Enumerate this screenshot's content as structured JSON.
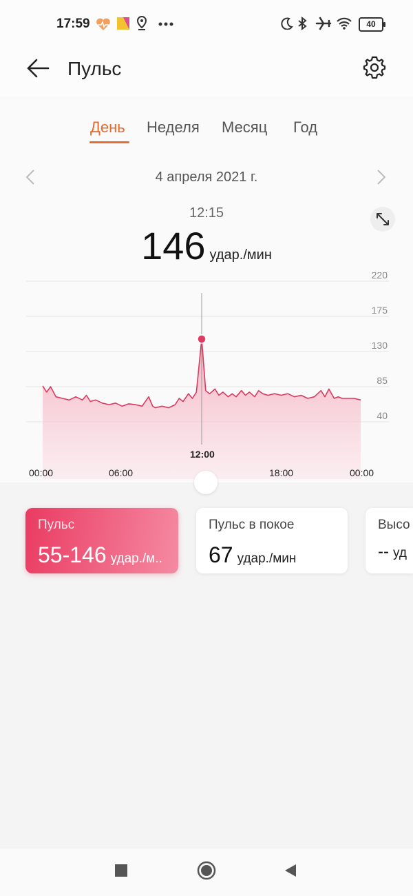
{
  "status_bar": {
    "time": "17:59",
    "left_icons": [
      "heart-rate-icon",
      "app-icon",
      "location-icon",
      "more-dots-icon"
    ],
    "right_icons": [
      "moon-icon",
      "bluetooth-icon",
      "airplane-icon",
      "wifi-icon"
    ],
    "battery": "40"
  },
  "header": {
    "title": "Пульс"
  },
  "tabs": [
    {
      "label": "День",
      "active": true
    },
    {
      "label": "Неделя",
      "active": false
    },
    {
      "label": "Месяц",
      "active": false
    },
    {
      "label": "Год",
      "active": false
    }
  ],
  "date_nav": {
    "date": "4 апреля 2021 г."
  },
  "reading": {
    "time": "12:15",
    "value": "146",
    "unit": "удар./мин"
  },
  "chart_data": {
    "type": "area",
    "x_ticks": [
      "00:00",
      "06:00",
      "12:00",
      "18:00",
      "00:00"
    ],
    "selected_x": "12:00",
    "y_ticks": [
      "220",
      "175",
      "130",
      "85",
      "40"
    ],
    "ylim": [
      40,
      220
    ],
    "x_hours": [
      0,
      0.3,
      0.6,
      1,
      1.5,
      2,
      2.5,
      3,
      3.3,
      3.6,
      4,
      4.5,
      5,
      5.5,
      6,
      6.5,
      7,
      7.5,
      8,
      8.3,
      8.5,
      9,
      9.5,
      10,
      10.3,
      10.6,
      11,
      11.3,
      11.6,
      12,
      12.3,
      12.6,
      13,
      13.3,
      13.6,
      14,
      14.3,
      14.6,
      15,
      15.3,
      15.6,
      16,
      16.3,
      16.6,
      17,
      17.5,
      18,
      18.5,
      19,
      19.5,
      20,
      20.5,
      21,
      21.3,
      21.6,
      22,
      22.3,
      22.6,
      23,
      23.5,
      24
    ],
    "y_values": [
      86,
      78,
      85,
      72,
      70,
      68,
      72,
      68,
      74,
      66,
      68,
      64,
      62,
      64,
      60,
      63,
      62,
      60,
      72,
      60,
      58,
      60,
      58,
      62,
      70,
      66,
      76,
      70,
      78,
      146,
      80,
      76,
      82,
      74,
      78,
      72,
      76,
      72,
      80,
      74,
      78,
      72,
      80,
      76,
      74,
      76,
      74,
      76,
      72,
      74,
      70,
      72,
      80,
      72,
      82,
      70,
      72,
      70,
      70,
      70,
      68
    ],
    "highlight": {
      "x": 12,
      "y": 146
    }
  },
  "cards": [
    {
      "label": "Пульс",
      "value": "55-146",
      "unit": "удар./м..",
      "active": true
    },
    {
      "label": "Пульс в покое",
      "value": "67",
      "unit": "удар./мин",
      "active": false
    },
    {
      "label": "Высо",
      "value": "--",
      "unit": "уд",
      "active": false
    }
  ],
  "nav_bar": {
    "buttons": [
      "recents-button",
      "home-button",
      "back-button"
    ]
  }
}
